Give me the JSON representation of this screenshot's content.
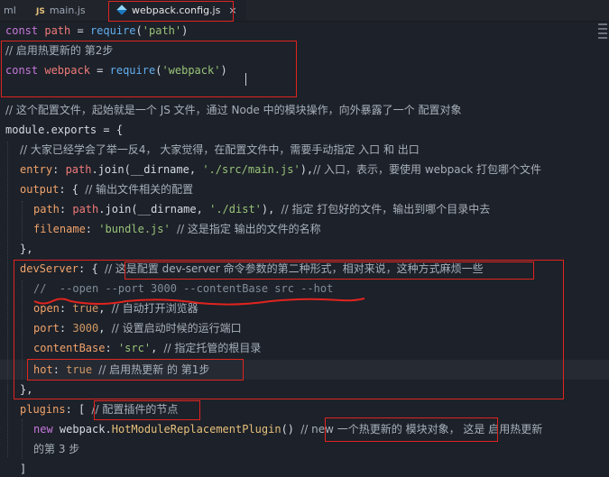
{
  "tabs": [
    {
      "label": "ml",
      "active": false
    },
    {
      "icon": "JS",
      "label": "main.js",
      "active": false
    },
    {
      "label": "webpack.config.js",
      "active": true,
      "close": "×"
    }
  ],
  "code": {
    "l1": {
      "a": "const ",
      "b": "path",
      "c": " = ",
      "d": "require",
      "e": "(",
      "f": "'path'",
      "g": ")"
    },
    "l2": {
      "a": "// 启用热更新的 第2步"
    },
    "l3": {
      "a": "const ",
      "b": "webpack",
      "c": " = ",
      "d": "require",
      "e": "(",
      "f": "'webpack'",
      "g": ")"
    },
    "l5": {
      "a": "// 这个配置文件，起始就是一个 JS 文件，通过 Node 中的模块操作，向外暴露了一个 配置对象"
    },
    "l6": {
      "a": "module",
      "b": ".exports = {"
    },
    "l7": {
      "a": "// 大家已经学会了举一反4， 大家觉得，在配置文件中，需要手动指定 入口 和 出口"
    },
    "l8": {
      "a": "entry",
      "b": ": ",
      "c": "path",
      "d": ".join(__dirname, ",
      "e": "'./src/main.js'",
      "f": "),",
      "g": "// 入口，表示，要使用 webpack 打包哪个文件"
    },
    "l9": {
      "a": "output",
      "b": ": { ",
      "c": "// 输出文件相关的配置"
    },
    "l10": {
      "a": "path",
      "b": ": ",
      "c": "path",
      "d": ".join(__dirname, ",
      "e": "'./dist'",
      "f": "), ",
      "g": "// 指定 打包好的文件，输出到哪个目录中去"
    },
    "l11": {
      "a": "filename",
      "b": ": ",
      "c": "'bundle.js'",
      "d": " ",
      "e": "// 这是指定 输出的文件的名称"
    },
    "l12": {
      "a": "},"
    },
    "l13": {
      "a": "devServer",
      "b": ": { ",
      "c": "// 这是配置 dev-server 命令参数的第二种形式，相对来说，这种方式麻烦一些"
    },
    "l14": {
      "a": "//  --open --port 3000 --contentBase src --hot"
    },
    "l15": {
      "a": "open",
      "b": ": ",
      "c": "true",
      "d": ", ",
      "e": "// 自动打开浏览器"
    },
    "l16": {
      "a": "port",
      "b": ": ",
      "c": "3000",
      "d": ", ",
      "e": "// 设置启动时候的运行端口"
    },
    "l17": {
      "a": "contentBase",
      "b": ": ",
      "c": "'src'",
      "d": ", ",
      "e": "// 指定托管的根目录"
    },
    "l18": {
      "a": "hot",
      "b": ": ",
      "c": "true",
      "d": " ",
      "e": "// 启用热更新 的 第1步"
    },
    "l19": {
      "a": "},"
    },
    "l20": {
      "a": "plugins",
      "b": ": [ ",
      "c": "// 配置插件的节点"
    },
    "l21": {
      "a": "new ",
      "b": "webpack",
      "c": ".",
      "d": "HotModuleReplacementPlugin",
      "e": "() ",
      "f": "// new 一个热更新的 模块对象， 这是 启用热更新"
    },
    "l22": {
      "a": "的第 3 步"
    },
    "l23": {
      "a": "]"
    }
  },
  "colors": {
    "background": "#1d2129",
    "annotation_red": "#e0241f"
  }
}
